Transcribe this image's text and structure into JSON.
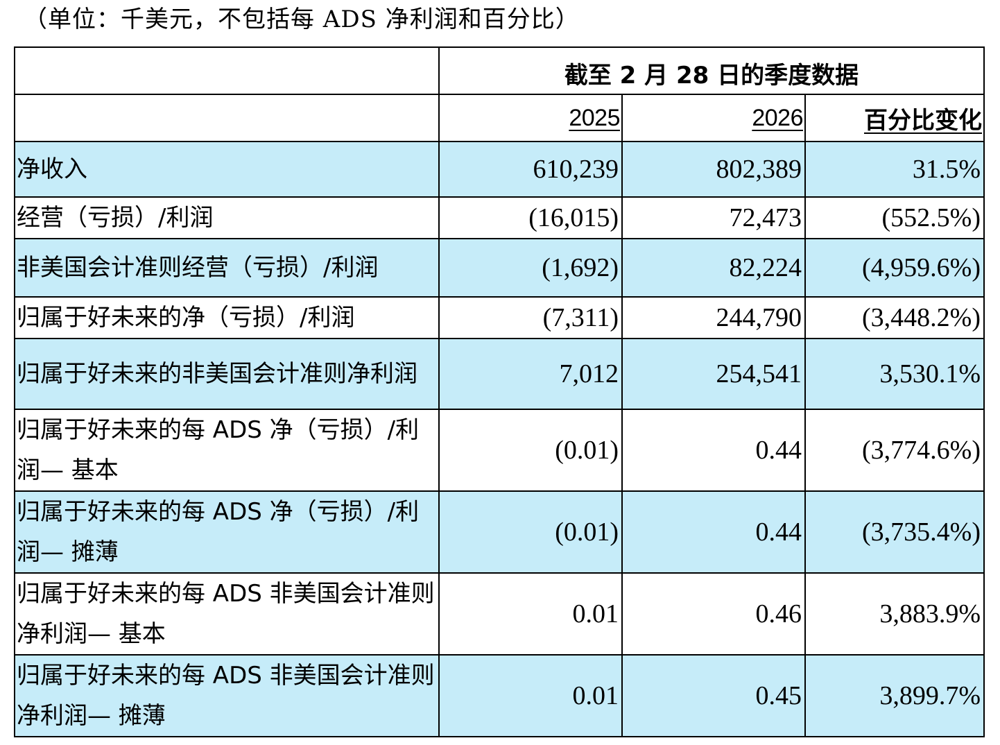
{
  "note": "（单位：千美元，不包括每 ADS 净利润和百分比）",
  "table": {
    "period_header": "截至 2 月 28 日的季度数据",
    "col_2025": "2025",
    "col_2026": "2026",
    "col_change": "百分比变化",
    "rows": [
      {
        "label": "净收入",
        "y2025": "610,239",
        "y2026": "802,389",
        "change": "31.5%"
      },
      {
        "label": "经营（亏损）/利润",
        "y2025": "(16,015)",
        "y2026": "72,473",
        "change": "(552.5%)"
      },
      {
        "label": "非美国会计准则经营（亏损）/利润",
        "y2025": "(1,692)",
        "y2026": "82,224",
        "change": "(4,959.6%)"
      },
      {
        "label": "归属于好未来的净（亏损）/利润",
        "y2025": "(7,311)",
        "y2026": "244,790",
        "change": "(3,448.2%)"
      },
      {
        "label": "归属于好未来的非美国会计准则净利润",
        "y2025": "7,012",
        "y2026": "254,541",
        "change": "3,530.1%"
      },
      {
        "label": "归属于好未来的每 ADS 净（亏损）/利润— 基本",
        "y2025": "(0.01)",
        "y2026": "0.44",
        "change": "(3,774.6%)"
      },
      {
        "label": "归属于好未来的每 ADS 净（亏损）/利润— 摊薄",
        "y2025": "(0.01)",
        "y2026": "0.44",
        "change": "(3,735.4%)"
      },
      {
        "label": "归属于好未来的每 ADS 非美国会计准则净利润— 基本",
        "y2025": "0.01",
        "y2026": "0.46",
        "change": "3,883.9%"
      },
      {
        "label": "归属于好未来的每 ADS 非美国会计准则净利润— 摊薄",
        "y2025": "0.01",
        "y2026": "0.45",
        "change": "3,899.7%"
      }
    ]
  }
}
